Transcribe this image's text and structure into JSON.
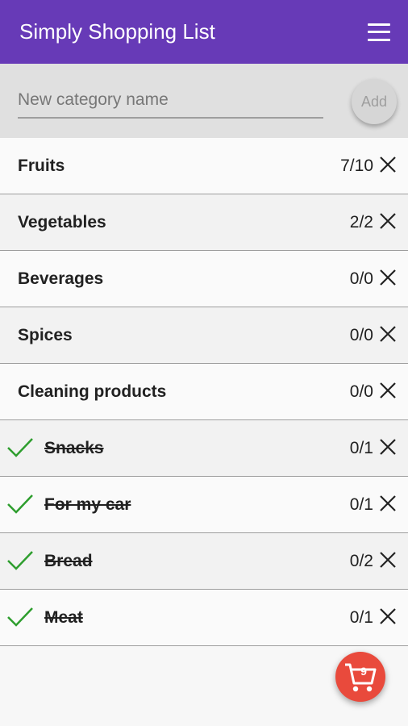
{
  "app": {
    "title": "Simply Shopping List"
  },
  "add_bar": {
    "placeholder": "New category name",
    "add_label": "Add"
  },
  "categories": [
    {
      "name": "Fruits",
      "count": "7/10",
      "done": false
    },
    {
      "name": "Vegetables",
      "count": "2/2",
      "done": false
    },
    {
      "name": "Beverages",
      "count": "0/0",
      "done": false
    },
    {
      "name": "Spices",
      "count": "0/0",
      "done": false
    },
    {
      "name": "Cleaning products",
      "count": "0/0",
      "done": false
    },
    {
      "name": "Snacks",
      "count": "0/1",
      "done": true
    },
    {
      "name": "For my car",
      "count": "0/1",
      "done": true
    },
    {
      "name": "Bread",
      "count": "0/2",
      "done": true
    },
    {
      "name": "Meat",
      "count": "0/1",
      "done": true
    }
  ],
  "cart": {
    "badge": "9"
  },
  "colors": {
    "appbar": "#673ab7",
    "check": "#2e9e2e",
    "fab": "#e94a3c"
  }
}
